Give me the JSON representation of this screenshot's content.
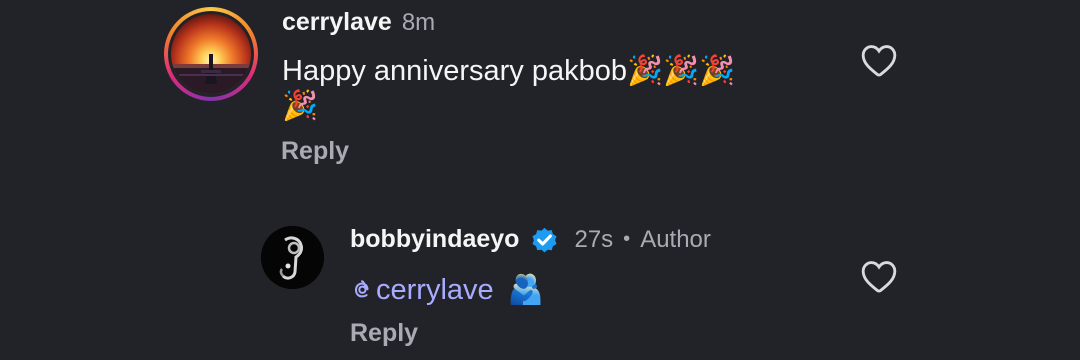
{
  "comments": [
    {
      "username": "cerrylave",
      "time": "8m",
      "text_line1": "Happy anniversary pakbob🎉🎉🎉",
      "text_line2": "🎉",
      "reply_label": "Reply",
      "avatar_icon": "sunset-pier-avatar-icon",
      "like_icon": "heart-outline-icon"
    },
    {
      "username": "bobbyindaeyo",
      "verified_icon": "verified-badge-icon",
      "time": "27s",
      "separator": "•",
      "author_badge": "Author",
      "mention": "cerrylave",
      "emoji": "🫂",
      "reply_label": "Reply",
      "avatar_icon": "headphones-avatar-icon",
      "like_icon": "heart-outline-icon"
    }
  ],
  "colors": {
    "background": "#222328",
    "mention": "#a9abff",
    "muted": "#a8abb3",
    "verified": "#1d9bf0"
  }
}
